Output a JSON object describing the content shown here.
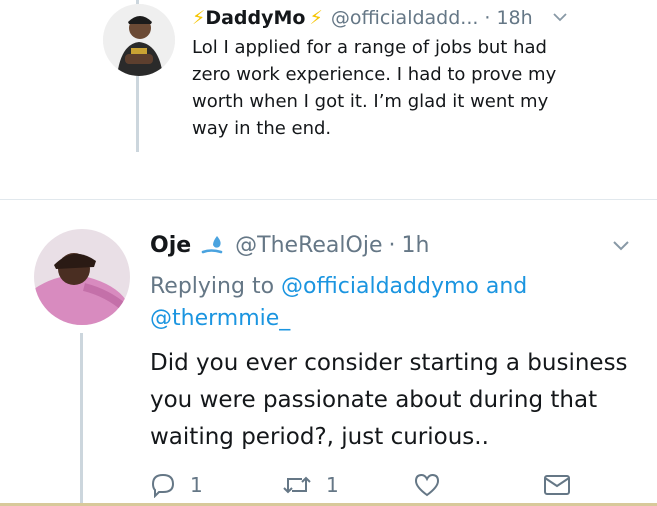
{
  "tweet1": {
    "name_prefix": "⚡",
    "name": "DaddyMo",
    "name_suffix": "⚡",
    "handle": "@officialdadd...",
    "dot": "·",
    "time": "18h",
    "text": "Lol I applied for a range of jobs but had zero work experience. I had to prove my worth when I got it. I’m glad it went my way in the end."
  },
  "tweet2": {
    "name": "Oje",
    "handle": "@TheRealOje",
    "dot": "·",
    "time": "1h",
    "replying_prefix": "Replying to",
    "replying_user1": "@officialdaddymo",
    "replying_and": "and",
    "replying_user2": "@thermmie_",
    "text": "Did you ever consider starting a business you were passionate about during that waiting period?, just curious..",
    "actions": {
      "reply_count": "1",
      "retweet_count": "1"
    }
  },
  "colors": {
    "link": "#1b95e0",
    "muted": "#657786",
    "thread_line": "#ccd6dd",
    "bolt": "#f5c400"
  },
  "icons": [
    "bolt-emoji",
    "chevron-down-icon",
    "droplet-icon",
    "reply-icon",
    "retweet-icon",
    "like-icon",
    "message-icon"
  ]
}
